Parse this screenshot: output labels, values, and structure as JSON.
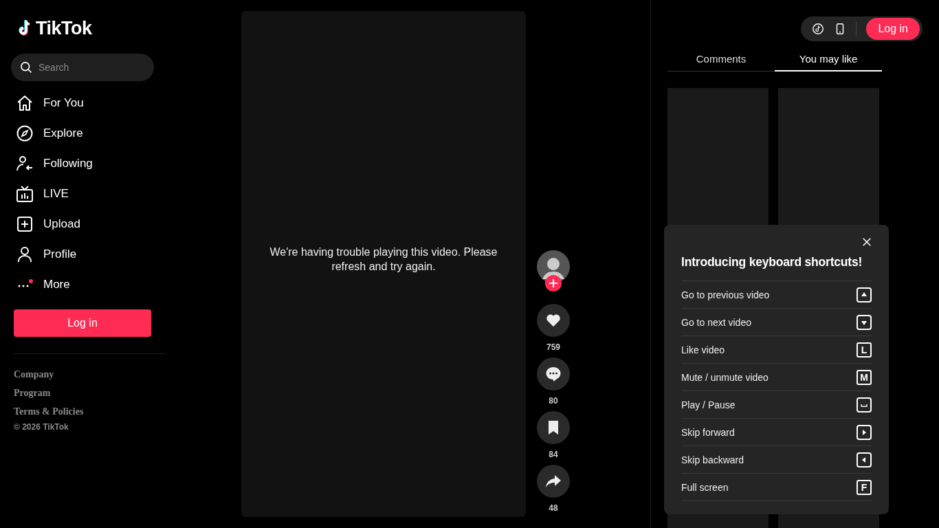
{
  "logo": {
    "text": "TikTok"
  },
  "search": {
    "placeholder": "Search"
  },
  "nav": [
    {
      "kind": "home",
      "label": "For You"
    },
    {
      "kind": "compass",
      "label": "Explore"
    },
    {
      "kind": "following",
      "label": "Following"
    },
    {
      "kind": "live",
      "label": "LIVE"
    },
    {
      "kind": "upload",
      "label": "Upload"
    },
    {
      "kind": "profile",
      "label": "Profile"
    },
    {
      "kind": "more",
      "label": "More"
    }
  ],
  "sidebar_login": "Log in",
  "footer_links": [
    "Company",
    "Program",
    "Terms & Policies"
  ],
  "copyright": "© 2026 TikTok",
  "video": {
    "message": "We're having trouble playing this video. Please refresh and try again."
  },
  "actions": [
    {
      "kind": "like",
      "count": "759"
    },
    {
      "kind": "comment",
      "count": "80"
    },
    {
      "kind": "save",
      "count": "84"
    },
    {
      "kind": "share",
      "count": "48"
    }
  ],
  "top_login": "Log in",
  "tabs": [
    {
      "label": "Comments",
      "selected": false
    },
    {
      "label": "You may like",
      "selected": true
    }
  ],
  "shortcuts": {
    "title": "Introducing keyboard shortcuts!",
    "items": [
      {
        "label": "Go to previous video",
        "kind": "up"
      },
      {
        "label": "Go to next video",
        "kind": "down"
      },
      {
        "label": "Like video",
        "kind": "letter",
        "key": "L"
      },
      {
        "label": "Mute / unmute video",
        "kind": "letter",
        "key": "M"
      },
      {
        "label": "Play / Pause",
        "kind": "space"
      },
      {
        "label": "Skip forward",
        "kind": "right"
      },
      {
        "label": "Skip backward",
        "kind": "left"
      },
      {
        "label": "Full screen",
        "kind": "letter",
        "key": "F"
      }
    ]
  }
}
